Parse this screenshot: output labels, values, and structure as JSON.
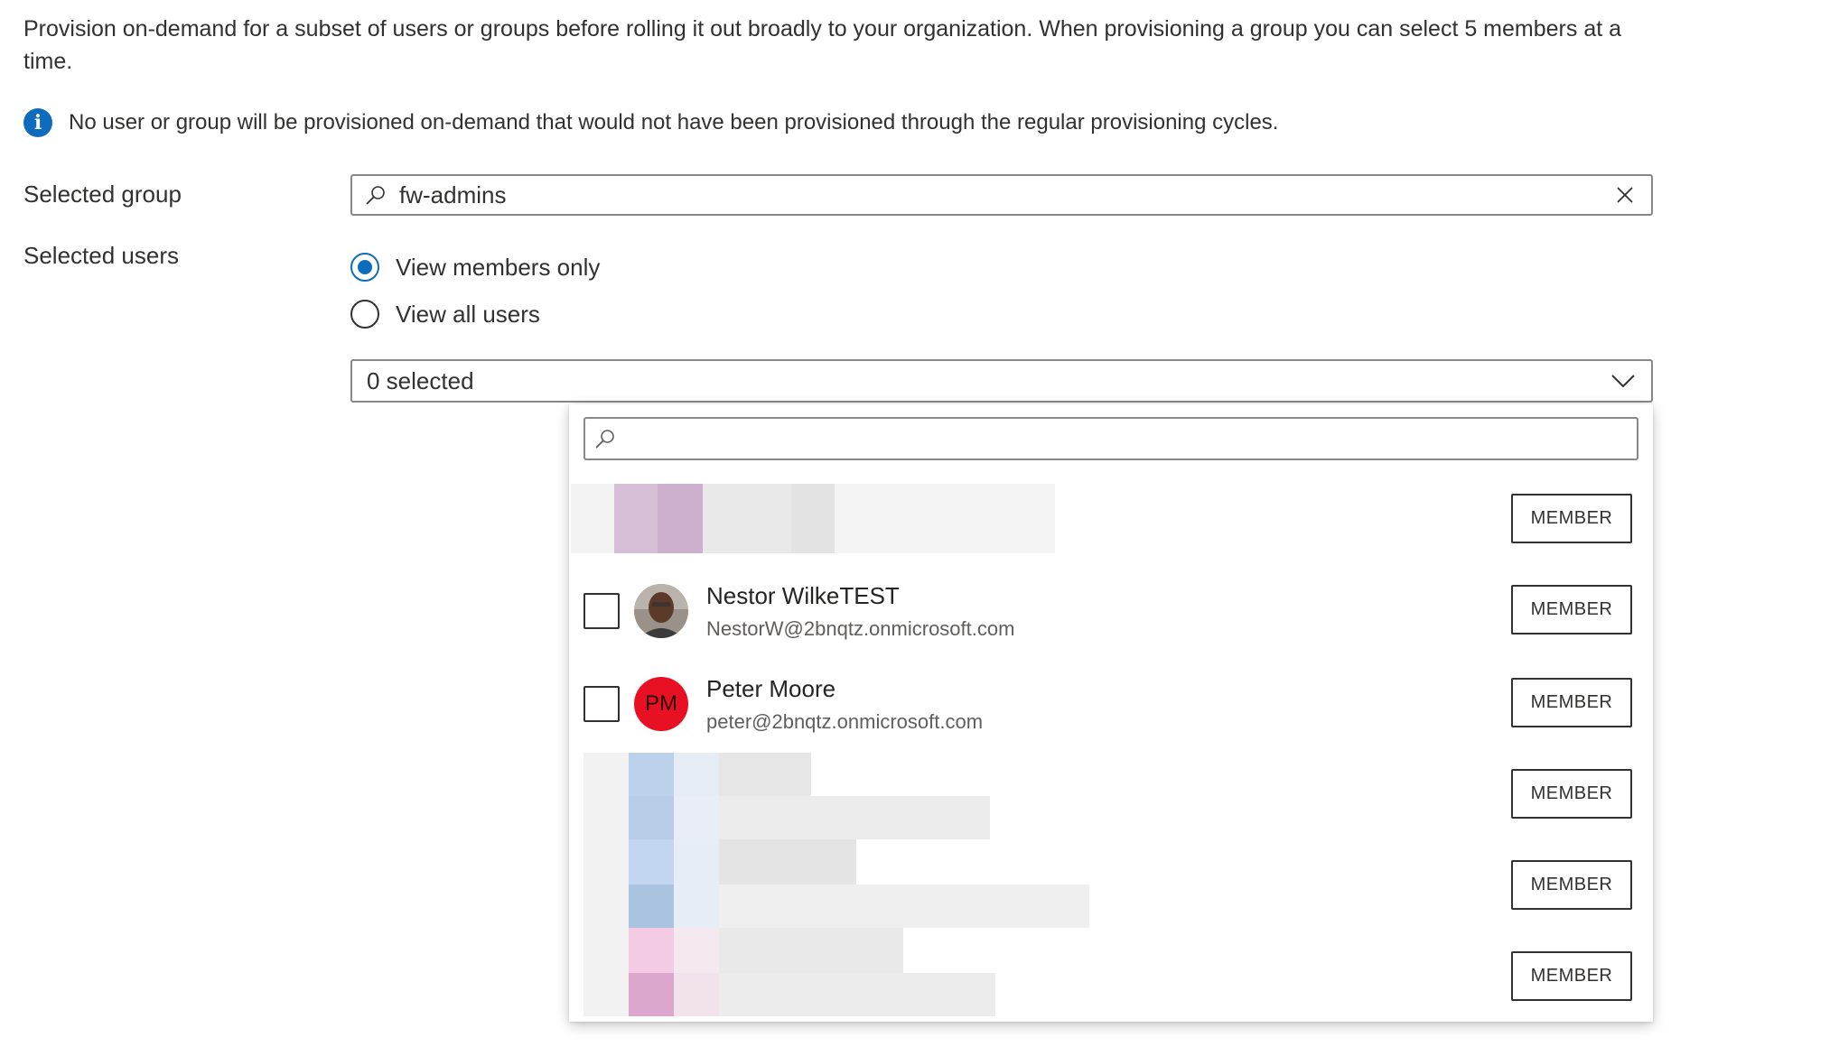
{
  "description": "Provision on-demand for a subset of users or groups before rolling it out broadly to your organization. When provisioning a group you can select 5 members at a time.",
  "info": {
    "icon": "info-icon",
    "text": "No user or group will be provisioned on-demand that would not have been provisioned through the regular provisioning cycles."
  },
  "selected_group": {
    "label": "Selected group",
    "value": "fw-admins"
  },
  "selected_users": {
    "label": "Selected users",
    "options": [
      {
        "label": "View members only",
        "checked": true
      },
      {
        "label": "View all users",
        "checked": false
      }
    ]
  },
  "dropdown": {
    "value": "0 selected",
    "search_value": ""
  },
  "members": [
    {
      "name": "",
      "email": "",
      "role": "MEMBER",
      "obscured": true
    },
    {
      "name": "Nestor WilkeTEST",
      "email": "NestorW@2bnqtz.onmicrosoft.com",
      "role": "MEMBER",
      "avatar": "photo"
    },
    {
      "name": "Peter Moore",
      "email": "peter@2bnqtz.onmicrosoft.com",
      "role": "MEMBER",
      "avatar_initials": "PM"
    },
    {
      "name": "",
      "email": "",
      "role": "MEMBER",
      "obscured": true
    },
    {
      "name": "",
      "email": "",
      "role": "MEMBER",
      "obscured": true
    },
    {
      "name": "",
      "email": "",
      "role": "MEMBER",
      "obscured": true
    }
  ],
  "colors": {
    "accent": "#0f6cbd",
    "avatar_pm": "#e81123",
    "border": "#8a8886"
  }
}
